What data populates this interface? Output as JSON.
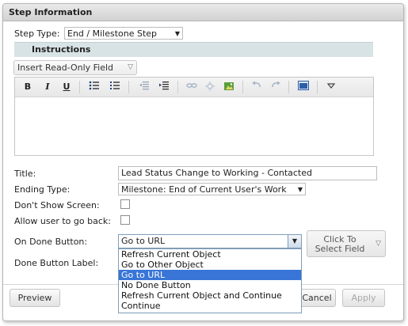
{
  "panel": {
    "title": "Step Information"
  },
  "step_type": {
    "label": "Step Type:",
    "value": "End / Milestone Step"
  },
  "instructions": {
    "label": "Instructions",
    "insert_field_label": "Insert Read-Only Field"
  },
  "toolbar": {
    "icons": [
      "bold-icon",
      "italic-icon",
      "underline-icon",
      "bulleted-list-icon",
      "numbered-list-icon",
      "outdent-icon",
      "indent-icon",
      "link-icon",
      "unlink-icon",
      "image-icon",
      "undo-icon",
      "redo-icon",
      "source-icon",
      "more-icon"
    ],
    "bold": "B",
    "italic": "I",
    "underline": "U"
  },
  "form": {
    "title_label": "Title:",
    "title_value": "Lead Status Change to Working - Contacted",
    "ending_type_label": "Ending Type:",
    "ending_type_value": "Milestone: End of Current User's Work",
    "dont_show_label": "Don't Show Screen:",
    "allow_back_label": "Allow user to go back:",
    "on_done_label": "On Done Button:",
    "on_done_value": "Go to URL",
    "done_button_label": "Done Button Label:",
    "select_field_line1": "Click To",
    "select_field_line2": "Select Field"
  },
  "dropdown": {
    "options": [
      "Refresh Current Object",
      "Go to Other Object",
      "Go to URL",
      "No Done Button",
      "Refresh Current Object and Continue",
      "Continue"
    ],
    "selected_index": 2
  },
  "footer": {
    "preview": "Preview",
    "cancel": "Cancel",
    "apply": "Apply"
  },
  "colors": {
    "selection": "#3875d7",
    "header_bar": "#d8e3e6"
  }
}
